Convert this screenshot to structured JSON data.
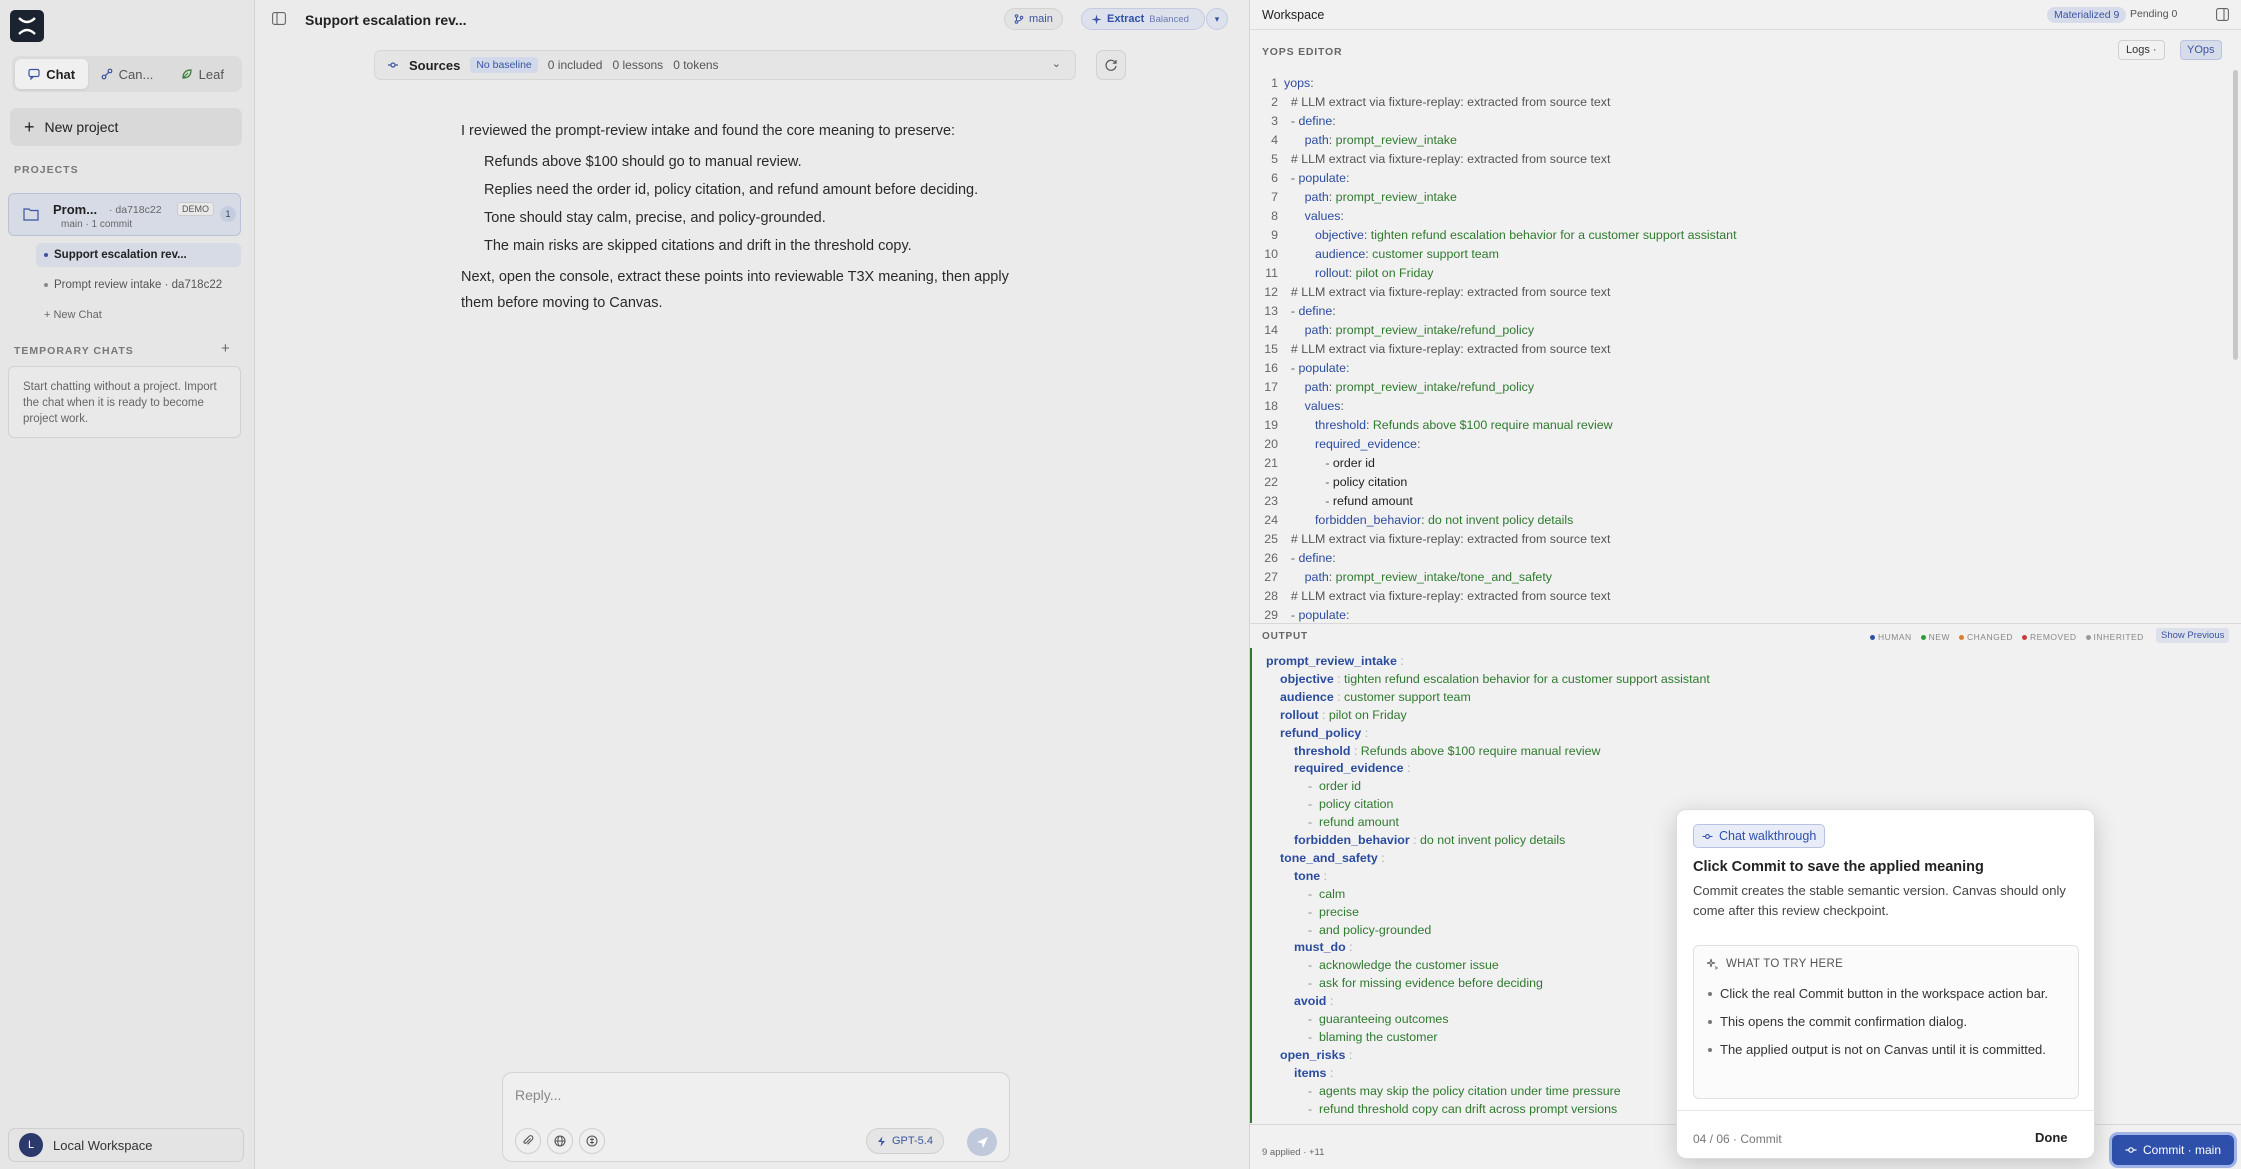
{
  "sidebar": {
    "modes": [
      {
        "label": "Chat",
        "icon": "chat-icon",
        "active": true
      },
      {
        "label": "Can...",
        "icon": "canvas-icon",
        "active": false
      },
      {
        "label": "Leaf",
        "icon": "leaf-icon",
        "active": false
      }
    ],
    "new_project": "New project",
    "projects_label": "PROJECTS",
    "project": {
      "name": "Prom...",
      "hash": "· da718c22",
      "badge": "DEMO",
      "count": "1",
      "meta": "main · 1 commit"
    },
    "chats": [
      {
        "label": "Support escalation rev...",
        "active": true
      },
      {
        "label": "Prompt review intake · da718c22",
        "active": false
      }
    ],
    "new_chat": "+ New Chat",
    "temporary_label": "TEMPORARY CHATS",
    "temporary_note": "Start chatting without a project. Import the chat when it is ready to become project work.",
    "workspace_initial": "L",
    "workspace_name": "Local Workspace"
  },
  "main": {
    "title": "Support escalation rev...",
    "branch": "main",
    "extract_label": "Extract",
    "extract_mode": "Balanced",
    "sources": {
      "label": "Sources",
      "badge": "No baseline",
      "included": "0 included",
      "lessons": "0 lessons",
      "tokens": "0 tokens"
    },
    "message": {
      "intro": "I reviewed the prompt-review intake and found the core meaning to preserve:",
      "points": [
        "Refunds above $100 should go to manual review.",
        "Replies need the order id, policy citation, and refund amount before deciding.",
        "Tone should stay calm, precise, and policy-grounded.",
        "The main risks are skipped citations and drift in the threshold copy."
      ],
      "outro": "Next, open the console, extract these points into reviewable T3X meaning, then apply them before moving to Canvas."
    },
    "composer": {
      "placeholder": "Reply...",
      "model": "GPT-5.4"
    }
  },
  "workspace": {
    "title": "Workspace",
    "materialized": "Materialized 9",
    "pending": "Pending 0",
    "editor_label": "YOPS EDITOR",
    "logs": "Logs ·",
    "yops": "YOps",
    "editor_lines": [
      {
        "n": "1",
        "parts": [
          [
            "k",
            "yops"
          ],
          [
            "c",
            ":"
          ]
        ]
      },
      {
        "n": "2",
        "parts": [
          [
            "c",
            "  # LLM extract via fixture-replay: extracted from source text"
          ]
        ]
      },
      {
        "n": "3",
        "parts": [
          [
            "c",
            "  - "
          ],
          [
            "d",
            "define"
          ],
          [
            "c",
            ":"
          ]
        ]
      },
      {
        "n": "4",
        "parts": [
          [
            "c",
            "      "
          ],
          [
            "k",
            "path"
          ],
          [
            "c",
            ": "
          ],
          [
            "v",
            "prompt_review_intake"
          ]
        ]
      },
      {
        "n": "5",
        "parts": [
          [
            "c",
            "  # LLM extract via fixture-replay: extracted from source text"
          ]
        ]
      },
      {
        "n": "6",
        "parts": [
          [
            "c",
            "  - "
          ],
          [
            "d",
            "populate"
          ],
          [
            "c",
            ":"
          ]
        ]
      },
      {
        "n": "7",
        "parts": [
          [
            "c",
            "      "
          ],
          [
            "k",
            "path"
          ],
          [
            "c",
            ": "
          ],
          [
            "v",
            "prompt_review_intake"
          ]
        ]
      },
      {
        "n": "8",
        "parts": [
          [
            "c",
            "      "
          ],
          [
            "k",
            "values"
          ],
          [
            "c",
            ":"
          ]
        ]
      },
      {
        "n": "9",
        "parts": [
          [
            "c",
            "         "
          ],
          [
            "k",
            "objective"
          ],
          [
            "c",
            ": "
          ],
          [
            "v",
            "tighten refund escalation behavior for a customer support assistant"
          ]
        ]
      },
      {
        "n": "10",
        "parts": [
          [
            "c",
            "         "
          ],
          [
            "k",
            "audience"
          ],
          [
            "c",
            ": "
          ],
          [
            "v",
            "customer support team"
          ]
        ]
      },
      {
        "n": "11",
        "parts": [
          [
            "c",
            "         "
          ],
          [
            "k",
            "rollout"
          ],
          [
            "c",
            ": "
          ],
          [
            "v",
            "pilot on Friday"
          ]
        ]
      },
      {
        "n": "12",
        "parts": [
          [
            "c",
            "  # LLM extract via fixture-replay: extracted from source text"
          ]
        ]
      },
      {
        "n": "13",
        "parts": [
          [
            "c",
            "  - "
          ],
          [
            "d",
            "define"
          ],
          [
            "c",
            ":"
          ]
        ]
      },
      {
        "n": "14",
        "parts": [
          [
            "c",
            "      "
          ],
          [
            "k",
            "path"
          ],
          [
            "c",
            ": "
          ],
          [
            "v",
            "prompt_review_intake/refund_policy"
          ]
        ]
      },
      {
        "n": "15",
        "parts": [
          [
            "c",
            "  # LLM extract via fixture-replay: extracted from source text"
          ]
        ]
      },
      {
        "n": "16",
        "parts": [
          [
            "c",
            "  - "
          ],
          [
            "d",
            "populate"
          ],
          [
            "c",
            ":"
          ]
        ]
      },
      {
        "n": "17",
        "parts": [
          [
            "c",
            "      "
          ],
          [
            "k",
            "path"
          ],
          [
            "c",
            ": "
          ],
          [
            "v",
            "prompt_review_intake/refund_policy"
          ]
        ]
      },
      {
        "n": "18",
        "parts": [
          [
            "c",
            "      "
          ],
          [
            "k",
            "values"
          ],
          [
            "c",
            ":"
          ]
        ]
      },
      {
        "n": "19",
        "parts": [
          [
            "c",
            "         "
          ],
          [
            "k",
            "threshold"
          ],
          [
            "c",
            ": "
          ],
          [
            "v",
            "Refunds above $100 require manual review"
          ]
        ]
      },
      {
        "n": "20",
        "parts": [
          [
            "c",
            "         "
          ],
          [
            "k",
            "required_evidence"
          ],
          [
            "c",
            ":"
          ]
        ]
      },
      {
        "n": "21",
        "parts": [
          [
            "c",
            "            - "
          ],
          [
            "t",
            "order id"
          ]
        ]
      },
      {
        "n": "22",
        "parts": [
          [
            "c",
            "            - "
          ],
          [
            "t",
            "policy citation"
          ]
        ]
      },
      {
        "n": "23",
        "parts": [
          [
            "c",
            "            - "
          ],
          [
            "t",
            "refund amount"
          ]
        ]
      },
      {
        "n": "24",
        "parts": [
          [
            "c",
            "         "
          ],
          [
            "k",
            "forbidden_behavior"
          ],
          [
            "c",
            ": "
          ],
          [
            "v",
            "do not invent policy details"
          ]
        ]
      },
      {
        "n": "25",
        "parts": [
          [
            "c",
            "  # LLM extract via fixture-replay: extracted from source text"
          ]
        ]
      },
      {
        "n": "26",
        "parts": [
          [
            "c",
            "  - "
          ],
          [
            "d",
            "define"
          ],
          [
            "c",
            ":"
          ]
        ]
      },
      {
        "n": "27",
        "parts": [
          [
            "c",
            "      "
          ],
          [
            "k",
            "path"
          ],
          [
            "c",
            ": "
          ],
          [
            "v",
            "prompt_review_intake/tone_and_safety"
          ]
        ]
      },
      {
        "n": "28",
        "parts": [
          [
            "c",
            "  # LLM extract via fixture-replay: extracted from source text"
          ]
        ]
      },
      {
        "n": "29",
        "parts": [
          [
            "c",
            "  - "
          ],
          [
            "d",
            "populate"
          ],
          [
            "c",
            ":"
          ]
        ]
      }
    ],
    "output_label": "OUTPUT",
    "legend": [
      {
        "label": "HUMAN",
        "color": "#2e4faa"
      },
      {
        "label": "NEW",
        "color": "#2f9a3f"
      },
      {
        "label": "CHANGED",
        "color": "#d9822b"
      },
      {
        "label": "REMOVED",
        "color": "#c93b3b"
      },
      {
        "label": "INHERITED",
        "color": "#999999"
      }
    ],
    "show_previous": "Show Previous",
    "output_lines": [
      {
        "i": 0,
        "key": "prompt_review_intake",
        "val": ""
      },
      {
        "i": 1,
        "key": "objective",
        "val": "tighten refund escalation behavior for a customer support assistant"
      },
      {
        "i": 1,
        "key": "audience",
        "val": "customer support team"
      },
      {
        "i": 1,
        "key": "rollout",
        "val": "pilot on Friday"
      },
      {
        "i": 1,
        "key": "refund_policy",
        "val": ""
      },
      {
        "i": 2,
        "key": "threshold",
        "val": "Refunds above $100 require manual review"
      },
      {
        "i": 2,
        "key": "required_evidence",
        "val": ""
      },
      {
        "i": 3,
        "item": "order id"
      },
      {
        "i": 3,
        "item": "policy citation"
      },
      {
        "i": 3,
        "item": "refund amount"
      },
      {
        "i": 2,
        "key": "forbidden_behavior",
        "val": "do not invent policy details"
      },
      {
        "i": 1,
        "key": "tone_and_safety",
        "val": ""
      },
      {
        "i": 2,
        "key": "tone",
        "val": ""
      },
      {
        "i": 3,
        "item": "calm"
      },
      {
        "i": 3,
        "item": "precise"
      },
      {
        "i": 3,
        "item": "and policy-grounded"
      },
      {
        "i": 2,
        "key": "must_do",
        "val": ""
      },
      {
        "i": 3,
        "item": "acknowledge the customer issue"
      },
      {
        "i": 3,
        "item": "ask for missing evidence before deciding"
      },
      {
        "i": 2,
        "key": "avoid",
        "val": ""
      },
      {
        "i": 3,
        "item": "guaranteeing outcomes"
      },
      {
        "i": 3,
        "item": "blaming the customer"
      },
      {
        "i": 1,
        "key": "open_risks",
        "val": ""
      },
      {
        "i": 2,
        "key": "items",
        "val": ""
      },
      {
        "i": 3,
        "item": "agents may skip the policy citation under time pressure"
      },
      {
        "i": 3,
        "item": "refund threshold copy can drift across prompt versions"
      }
    ],
    "applied_note": "9 applied · +11",
    "commit_label": "Commit · main"
  },
  "tour": {
    "chip": "Chat walkthrough",
    "title": "Click Commit to save the applied meaning",
    "body": "Commit creates the stable semantic version. Canvas should only come after this review checkpoint.",
    "try_label": "WHAT TO TRY HERE",
    "tips": [
      "Click the real Commit button in the workspace action bar.",
      "This opens the commit confirmation dialog.",
      "The applied output is not on Canvas until it is committed."
    ],
    "step": "04 / 06 · Commit",
    "done": "Done"
  }
}
